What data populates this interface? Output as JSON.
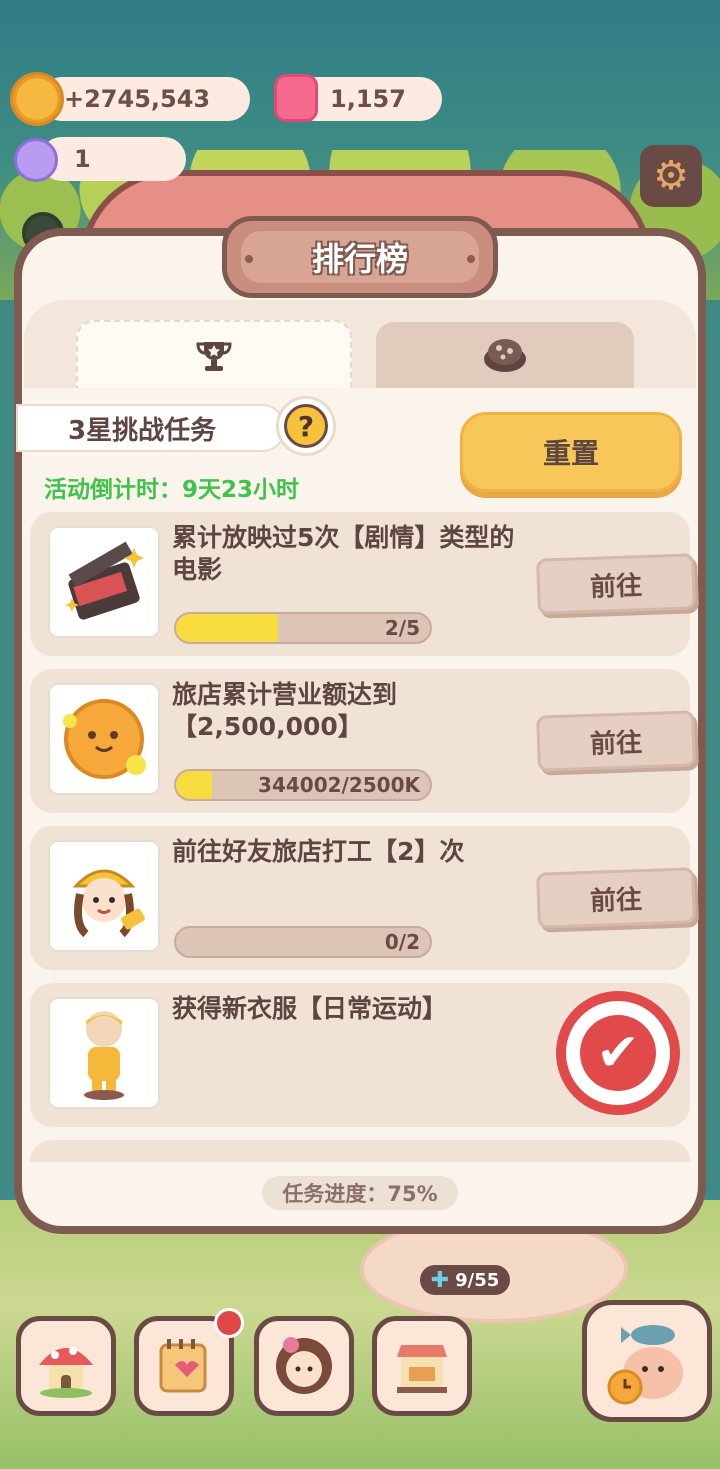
{
  "currency": {
    "coins_label": "+2745,543",
    "gems": "1,157",
    "tickets": "1"
  },
  "scene": {
    "guest_counter": "9/55"
  },
  "panel": {
    "title": "排行榜",
    "tabs": [
      {
        "icon": "trophy-icon",
        "active": true
      },
      {
        "icon": "cookie-icon",
        "active": false
      }
    ],
    "section_label": "3星挑战任务",
    "help_label": "?",
    "countdown": "活动倒计时：9天23小时",
    "reset_label": "重置",
    "tasks": [
      {
        "title": "累计放映过5次【剧情】类型的电影",
        "progress_text": "2/5",
        "progress": 0.4,
        "button": "前往",
        "icon": "clapperboard-icon"
      },
      {
        "title": "旅店累计营业额达到【2,500,000】",
        "progress_text": "344002/2500K",
        "progress": 0.14,
        "button": "前往",
        "icon": "cookie-coin-icon"
      },
      {
        "title": "前往好友旅店打工【2】次",
        "progress_text": "0/2",
        "progress": 0,
        "button": "前往",
        "icon": "worker-character-icon"
      },
      {
        "title": "获得新衣服【日常运动】",
        "completed": true,
        "icon": "outfit-figure-icon"
      }
    ],
    "footer_progress": "任务进度：75%"
  },
  "nav": [
    {
      "icon": "mushroom-house-icon"
    },
    {
      "icon": "notebook-icon",
      "badge": true
    },
    {
      "icon": "character-portrait-icon"
    },
    {
      "icon": "shop-stall-icon"
    },
    {
      "icon": "fish-cat-alarm-icon"
    }
  ],
  "colors": {
    "panel_border": "#7e5a50",
    "panel_bg": "#fbf4ec",
    "accent_yellow": "#f8c75a",
    "countdown_green": "#3fc34a",
    "stamp_red": "#e04a4a"
  }
}
